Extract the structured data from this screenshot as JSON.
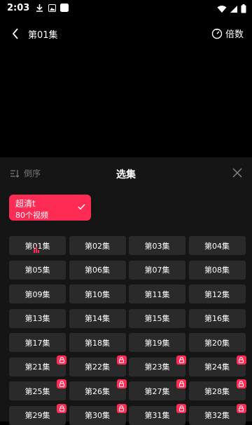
{
  "status": {
    "time": "2:03"
  },
  "player": {
    "title": "第01集",
    "speed_label": "倍数"
  },
  "panel": {
    "sort_label": "倒序",
    "title": "选集",
    "quality": {
      "name": "超清t",
      "count": "80个视频"
    }
  },
  "episodes": [
    {
      "label": "第01集",
      "playing": true,
      "locked": false
    },
    {
      "label": "第02集",
      "locked": false
    },
    {
      "label": "第03集",
      "locked": false
    },
    {
      "label": "第04集",
      "locked": false
    },
    {
      "label": "第05集",
      "locked": false
    },
    {
      "label": "第06集",
      "locked": false
    },
    {
      "label": "第07集",
      "locked": false
    },
    {
      "label": "第08集",
      "locked": false
    },
    {
      "label": "第09集",
      "locked": false
    },
    {
      "label": "第10集",
      "locked": false
    },
    {
      "label": "第11集",
      "locked": false
    },
    {
      "label": "第12集",
      "locked": false
    },
    {
      "label": "第13集",
      "locked": false
    },
    {
      "label": "第14集",
      "locked": false
    },
    {
      "label": "第15集",
      "locked": false
    },
    {
      "label": "第16集",
      "locked": false
    },
    {
      "label": "第17集",
      "locked": false
    },
    {
      "label": "第18集",
      "locked": false
    },
    {
      "label": "第19集",
      "locked": false
    },
    {
      "label": "第20集",
      "locked": false
    },
    {
      "label": "第21集",
      "locked": true
    },
    {
      "label": "第22集",
      "locked": true
    },
    {
      "label": "第23集",
      "locked": true
    },
    {
      "label": "第24集",
      "locked": true
    },
    {
      "label": "第25集",
      "locked": true
    },
    {
      "label": "第26集",
      "locked": true
    },
    {
      "label": "第27集",
      "locked": true
    },
    {
      "label": "第28集",
      "locked": true
    },
    {
      "label": "第29集",
      "locked": true
    },
    {
      "label": "第30集",
      "locked": true
    },
    {
      "label": "第31集",
      "locked": true
    },
    {
      "label": "第32集",
      "locked": true
    }
  ],
  "colors": {
    "accent": "#fe2c55",
    "tile": "#2a2a2a",
    "panel": "#151515"
  }
}
